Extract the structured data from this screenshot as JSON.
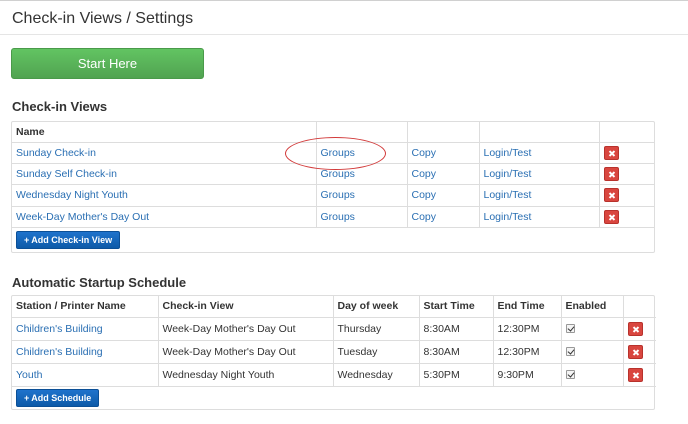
{
  "page": {
    "title": "Check-in Views / Settings"
  },
  "start_button": {
    "label": "Start Here"
  },
  "checkin_views": {
    "title": "Check-in Views",
    "header": {
      "name": "Name"
    },
    "rows": [
      {
        "name": "Sunday Check-in",
        "groups": "Groups",
        "copy": "Copy",
        "login": "Login/Test"
      },
      {
        "name": "Sunday Self Check-in",
        "groups": "Groups",
        "copy": "Copy",
        "login": "Login/Test"
      },
      {
        "name": "Wednesday Night Youth",
        "groups": "Groups",
        "copy": "Copy",
        "login": "Login/Test"
      },
      {
        "name": "Week-Day Mother's Day Out",
        "groups": "Groups",
        "copy": "Copy",
        "login": "Login/Test"
      }
    ],
    "add_label": "Add Check-in View"
  },
  "schedule": {
    "title": "Automatic Startup Schedule",
    "headers": {
      "station": "Station / Printer Name",
      "view": "Check-in View",
      "day": "Day of week",
      "start": "Start Time",
      "end": "End Time",
      "enabled": "Enabled"
    },
    "rows": [
      {
        "station": "Children's Building",
        "view": "Week-Day Mother's Day Out",
        "day": "Thursday",
        "start": "8:30AM",
        "end": "12:30PM",
        "enabled": true
      },
      {
        "station": "Children's Building",
        "view": "Week-Day Mother's Day Out",
        "day": "Tuesday",
        "start": "8:30AM",
        "end": "12:30PM",
        "enabled": true
      },
      {
        "station": "Youth",
        "view": "Wednesday Night Youth",
        "day": "Wednesday",
        "start": "5:30PM",
        "end": "9:30PM",
        "enabled": true
      }
    ],
    "add_label": "Add Schedule"
  },
  "icons": {
    "delete": "delete-x-icon",
    "add": "plus-icon",
    "check": "checkbox-checked-icon"
  },
  "colors": {
    "link": "#2a6fb3",
    "start_button": "#5cb85c",
    "delete_button": "#d9463f",
    "add_button": "#1267be",
    "annotation": "#d23a3a"
  }
}
